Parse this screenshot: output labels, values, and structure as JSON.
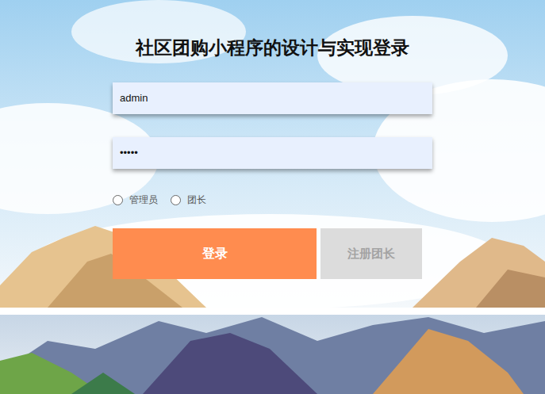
{
  "title": "社区团购小程序的设计与实现登录",
  "fields": [
    {
      "name": "username",
      "value": "admin",
      "kind": "text"
    },
    {
      "name": "password",
      "value": "•••••",
      "kind": "password"
    }
  ],
  "roles": [
    {
      "label": "管理员",
      "selected": false
    },
    {
      "label": "团长",
      "selected": false
    }
  ],
  "buttons": [
    {
      "label": "登录",
      "kind": "primary"
    },
    {
      "label": "注册团长",
      "kind": "secondary"
    }
  ]
}
